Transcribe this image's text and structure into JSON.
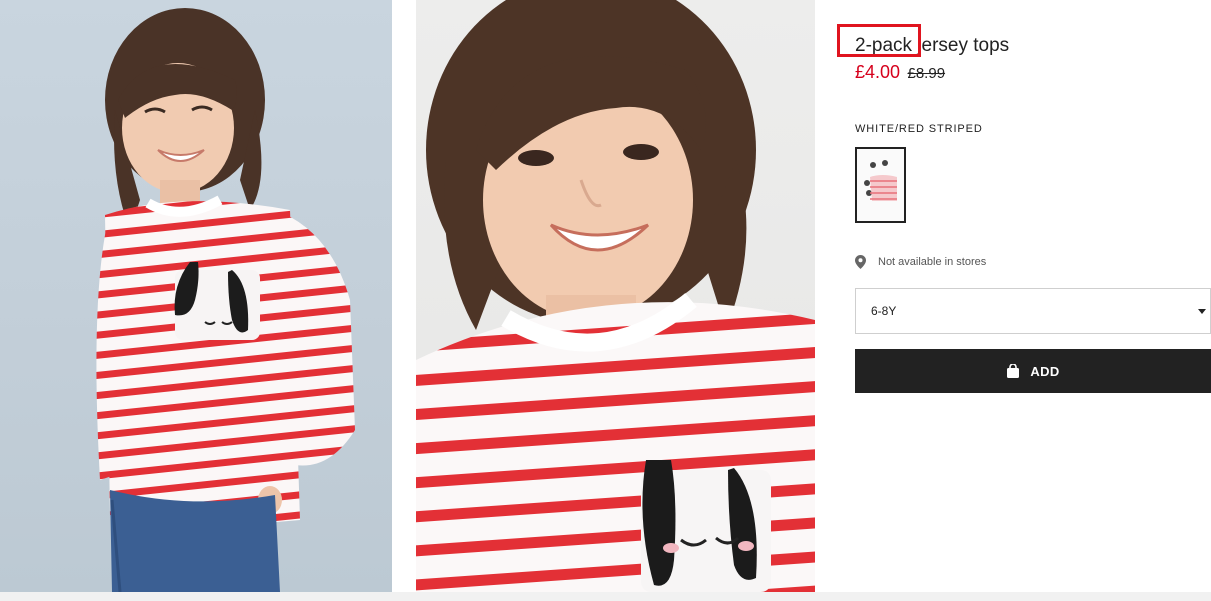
{
  "product": {
    "title": "2-pack jersey tops",
    "price_current": "£4.00",
    "price_original": "£8.99",
    "color_label": "WHITE/RED STRIPED",
    "availability": "Not available in stores",
    "size_selected": "6-8Y",
    "add_button_label": "ADD"
  },
  "images": {
    "main_photo": "product-photo-full",
    "detail_photo": "product-photo-closeup",
    "swatch": "white-red-striped-swatch"
  },
  "colors": {
    "accent_red": "#d6001c",
    "highlight_red": "#e0141f",
    "button_black": "#222222",
    "stripe_red": "#e33036",
    "photo1_bg": "#c5d1db",
    "photo2_bg": "#ebebea"
  },
  "icons": {
    "location": "location-pin-icon",
    "bag": "shopping-bag-icon",
    "dropdown": "chevron-down-icon"
  }
}
